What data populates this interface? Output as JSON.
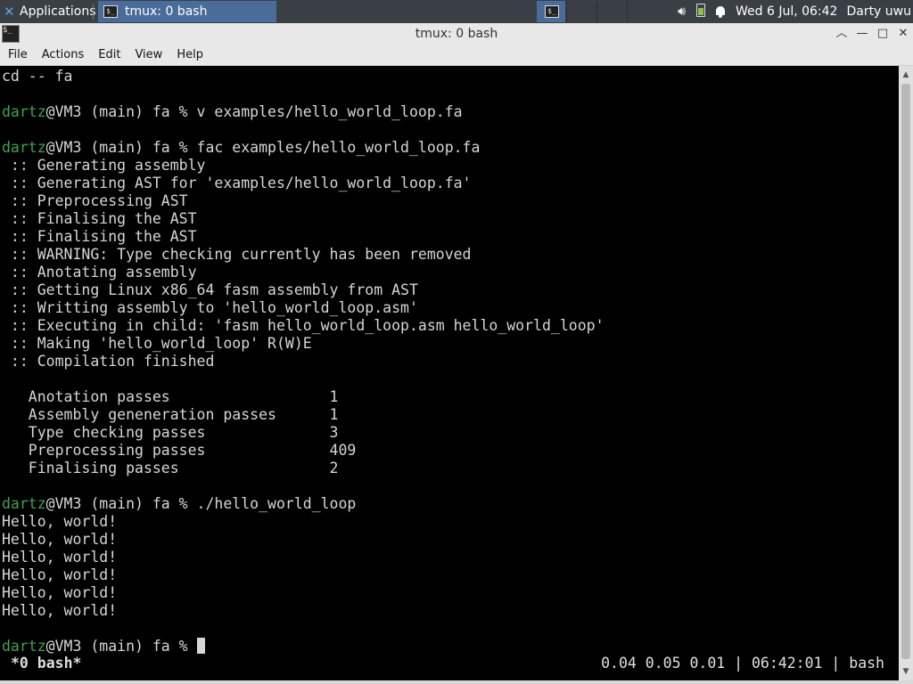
{
  "panel": {
    "applications_label": "Applications",
    "task_title": "tmux: 0 bash",
    "clock": "Wed  6 Jul, 06:42",
    "user": "Darty uwu"
  },
  "window": {
    "title": "tmux: 0 bash"
  },
  "menu": [
    "File",
    "Actions",
    "Edit",
    "View",
    "Help"
  ],
  "terminal": {
    "lines": [
      {
        "text": "cd -- fa"
      },
      {
        "text": ""
      },
      {
        "user": "dartz",
        "text": "@VM3 (main) fa % v examples/hello_world_loop.fa"
      },
      {
        "text": ""
      },
      {
        "user": "dartz",
        "text": "@VM3 (main) fa % fac examples/hello_world_loop.fa"
      },
      {
        "text": " :: Generating assembly"
      },
      {
        "text": " :: Generating AST for 'examples/hello_world_loop.fa'"
      },
      {
        "text": " :: Preprocessing AST"
      },
      {
        "text": " :: Finalising the AST"
      },
      {
        "text": " :: Finalising the AST"
      },
      {
        "text": " :: WARNING: Type checking currently has been removed"
      },
      {
        "text": " :: Anotating assembly"
      },
      {
        "text": " :: Getting Linux x86_64 fasm assembly from AST"
      },
      {
        "text": " :: Writting assembly to 'hello_world_loop.asm'"
      },
      {
        "text": " :: Executing in child: 'fasm hello_world_loop.asm hello_world_loop'"
      },
      {
        "text": " :: Making 'hello_world_loop' R(W)E"
      },
      {
        "text": " :: Compilation finished"
      },
      {
        "text": ""
      },
      {
        "text": "   Anotation passes                  1"
      },
      {
        "text": "   Assembly geneneration passes      1"
      },
      {
        "text": "   Type checking passes              3"
      },
      {
        "text": "   Preprocessing passes              409"
      },
      {
        "text": "   Finalising passes                 2"
      },
      {
        "text": ""
      },
      {
        "user": "dartz",
        "text": "@VM3 (main) fa % ./hello_world_loop"
      },
      {
        "text": "Hello, world!"
      },
      {
        "text": "Hello, world!"
      },
      {
        "text": "Hello, world!"
      },
      {
        "text": "Hello, world!"
      },
      {
        "text": "Hello, world!"
      },
      {
        "text": "Hello, world!"
      },
      {
        "text": ""
      },
      {
        "user": "dartz",
        "text": "@VM3 (main) fa % ",
        "cursor": true
      }
    ],
    "status_left": "*0 bash*",
    "status_right": "0.04 0.05 0.01 | 06:42:01 | bash"
  },
  "colors": {
    "prompt_user": "#3aa54a",
    "terminal_bg": "#000000",
    "terminal_fg": "#d6d6d6"
  }
}
